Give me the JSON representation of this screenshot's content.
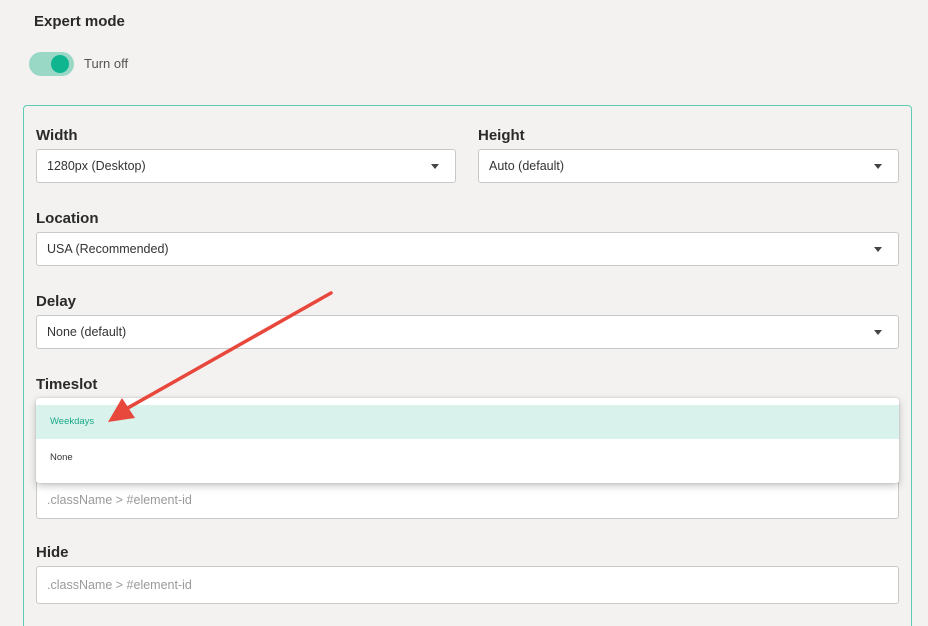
{
  "expert_mode": {
    "title": "Expert mode",
    "toggle_label": "Turn off",
    "toggle_on": true,
    "accent_color": "#0fb58f"
  },
  "fields": {
    "width": {
      "label": "Width",
      "value": "1280px (Desktop)"
    },
    "height": {
      "label": "Height",
      "value": "Auto (default)"
    },
    "location": {
      "label": "Location",
      "value": "USA (Recommended)"
    },
    "delay": {
      "label": "Delay",
      "value": "None (default)"
    },
    "timeslot": {
      "label": "Timeslot",
      "options": [
        "Weekdays",
        "None"
      ],
      "highlighted": "Weekdays"
    },
    "selector": {
      "placeholder": ".className > #element-id"
    },
    "hide": {
      "label": "Hide",
      "placeholder": ".className > #element-id"
    }
  },
  "annotation": {
    "arrow_color": "#e8473c"
  }
}
